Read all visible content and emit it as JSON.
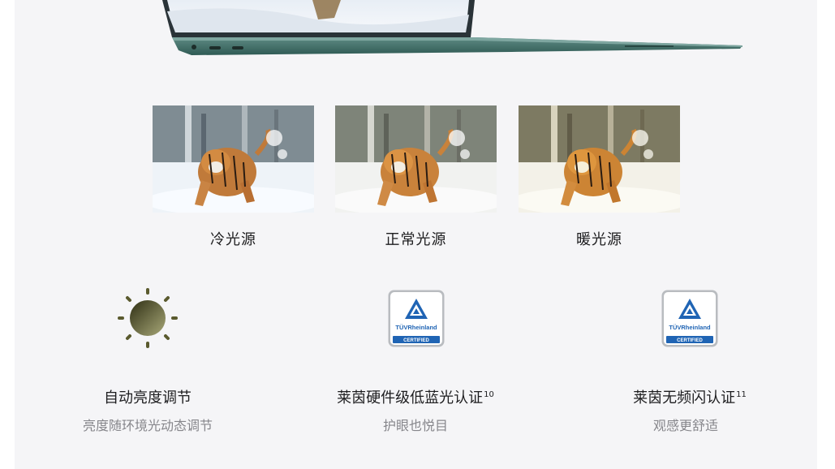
{
  "light_modes": [
    {
      "label": "冷光源"
    },
    {
      "label": "正常光源"
    },
    {
      "label": "暖光源"
    }
  ],
  "features": [
    {
      "title": "自动亮度调节",
      "sup": "",
      "subtitle": "亮度随环境光动态调节",
      "icon": "sun-icon"
    },
    {
      "title": "莱茵硬件级低蓝光认证",
      "sup": "10",
      "subtitle": "护眼也悦目",
      "icon": "tuv-certified-icon"
    },
    {
      "title": "莱茵无频闪认证",
      "sup": "11",
      "subtitle": "观感更舒适",
      "icon": "tuv-certified-icon"
    }
  ],
  "badge": {
    "brand": "TÜVRheinland",
    "tag": "CERTIFIED"
  },
  "colors": {
    "background": "#f5f5f7",
    "laptop_body": "#3d6f68",
    "sun": "#5a5a2e",
    "tuv_blue": "#1f64b4"
  }
}
